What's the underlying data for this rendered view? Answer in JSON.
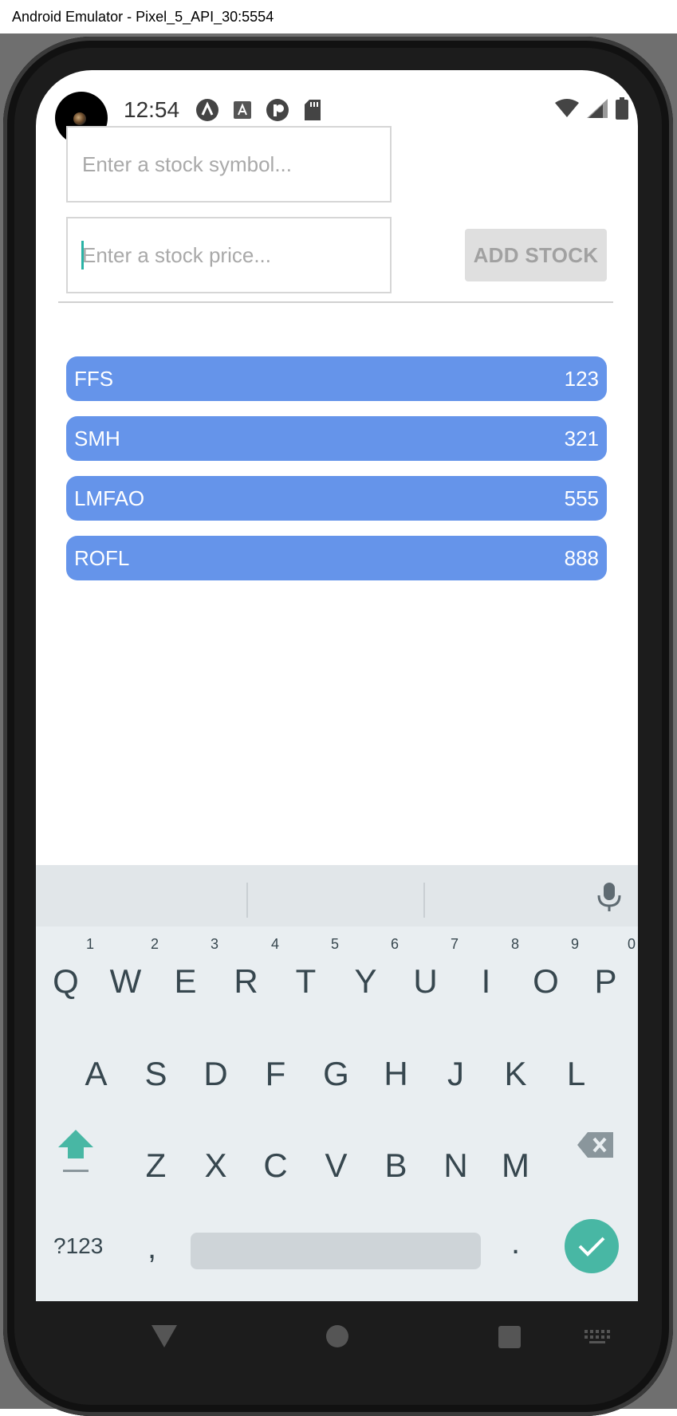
{
  "window": {
    "title": "Android Emulator - Pixel_5_API_30:5554"
  },
  "statusbar": {
    "time": "12:54",
    "icons": [
      "a-icon",
      "font-a-icon",
      "r-icon",
      "sd-card-icon"
    ],
    "right_icons": [
      "wifi-icon",
      "signal-icon",
      "battery-icon"
    ]
  },
  "form": {
    "symbol_placeholder": "Enter a stock symbol...",
    "price_placeholder": "Enter a stock price...",
    "add_button_label": "ADD STOCK"
  },
  "stocks": [
    {
      "symbol": "FFS",
      "price": "123"
    },
    {
      "symbol": "SMH",
      "price": "321"
    },
    {
      "symbol": "LMFAO",
      "price": "555"
    },
    {
      "symbol": "ROFL",
      "price": "888"
    }
  ],
  "colors": {
    "stock_row": "#6594ea",
    "accent": "#48b7a4",
    "button_disabled": "#dfdfdf"
  },
  "keyboard": {
    "row1": [
      {
        "key": "Q",
        "hint": "1"
      },
      {
        "key": "W",
        "hint": "2"
      },
      {
        "key": "E",
        "hint": "3"
      },
      {
        "key": "R",
        "hint": "4"
      },
      {
        "key": "T",
        "hint": "5"
      },
      {
        "key": "Y",
        "hint": "6"
      },
      {
        "key": "U",
        "hint": "7"
      },
      {
        "key": "I",
        "hint": "8"
      },
      {
        "key": "O",
        "hint": "9"
      },
      {
        "key": "P",
        "hint": "0"
      }
    ],
    "row2": [
      "A",
      "S",
      "D",
      "F",
      "G",
      "H",
      "J",
      "K",
      "L"
    ],
    "row3": [
      "Z",
      "X",
      "C",
      "V",
      "B",
      "N",
      "M"
    ],
    "symbols_label": "?123",
    "comma": ",",
    "period": "."
  }
}
